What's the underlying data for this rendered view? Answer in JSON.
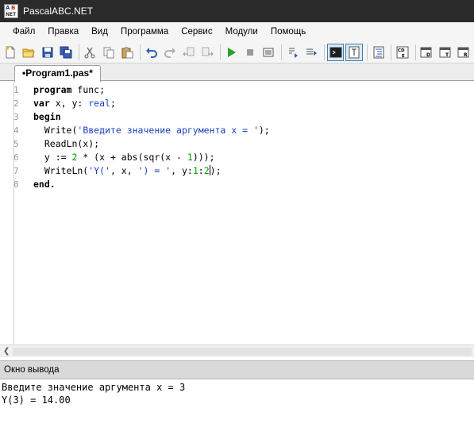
{
  "window": {
    "title": "PascalABC.NET"
  },
  "menu": {
    "items": [
      "Файл",
      "Правка",
      "Вид",
      "Программа",
      "Сервис",
      "Модули",
      "Помощь"
    ]
  },
  "toolbar": {
    "buttons": [
      "new-file-icon",
      "open-folder-icon",
      "save-icon",
      "save-all-icon",
      "cut-icon",
      "copy-icon",
      "paste-icon",
      "undo-icon",
      "redo-icon",
      "navigate-back-icon",
      "navigate-forward-icon",
      "run-icon",
      "stop-icon",
      "compile-icon",
      "step-over-icon",
      "step-into-icon",
      "console-window-icon",
      "text-window-icon",
      "format-code-icon",
      "code-template-icon",
      "form-designer-icon",
      "insert-text-icon",
      "replace-icon"
    ]
  },
  "tabs": [
    {
      "label": "•Program1.pas*",
      "active": true
    }
  ],
  "editor": {
    "line_numbers": [
      "1",
      "2",
      "3",
      "4",
      "5",
      "6",
      "7",
      "8"
    ],
    "lines": [
      [
        {
          "t": "program",
          "c": "kw"
        },
        {
          "t": " func;",
          "c": ""
        }
      ],
      [
        {
          "t": "var",
          "c": "kw"
        },
        {
          "t": " x, y: ",
          "c": ""
        },
        {
          "t": "real",
          "c": "typ"
        },
        {
          "t": ";",
          "c": ""
        }
      ],
      [
        {
          "t": "begin",
          "c": "kw"
        }
      ],
      [
        {
          "t": "  Write(",
          "c": ""
        },
        {
          "t": "'Введите значение аргумента x = '",
          "c": "str"
        },
        {
          "t": ");",
          "c": ""
        }
      ],
      [
        {
          "t": "  ReadLn(x);",
          "c": ""
        }
      ],
      [
        {
          "t": "  y := ",
          "c": ""
        },
        {
          "t": "2",
          "c": "num"
        },
        {
          "t": " * (x + abs(sqr(x - ",
          "c": ""
        },
        {
          "t": "1",
          "c": "num"
        },
        {
          "t": ")));",
          "c": ""
        }
      ],
      [
        {
          "t": "  WriteLn(",
          "c": ""
        },
        {
          "t": "'Y('",
          "c": "str"
        },
        {
          "t": ", x, ",
          "c": ""
        },
        {
          "t": "') = '",
          "c": "str"
        },
        {
          "t": ", y:",
          "c": ""
        },
        {
          "t": "1",
          "c": "num"
        },
        {
          "t": ":",
          "c": ""
        },
        {
          "t": "2",
          "c": "num"
        },
        {
          "t": "|caret|",
          "c": "caret"
        },
        {
          "t": ");",
          "c": ""
        }
      ],
      [
        {
          "t": "end.",
          "c": "kw"
        }
      ]
    ]
  },
  "output": {
    "title": "Окно вывода",
    "lines": [
      "Введите значение аргумента x = 3",
      "Y(3) = 14.00"
    ]
  },
  "colors": {
    "titlebar": "#2b2b2b",
    "keyword": "#000000",
    "string": "#1a3fbf",
    "number": "#009900",
    "line_number": "#9a9a9a"
  }
}
